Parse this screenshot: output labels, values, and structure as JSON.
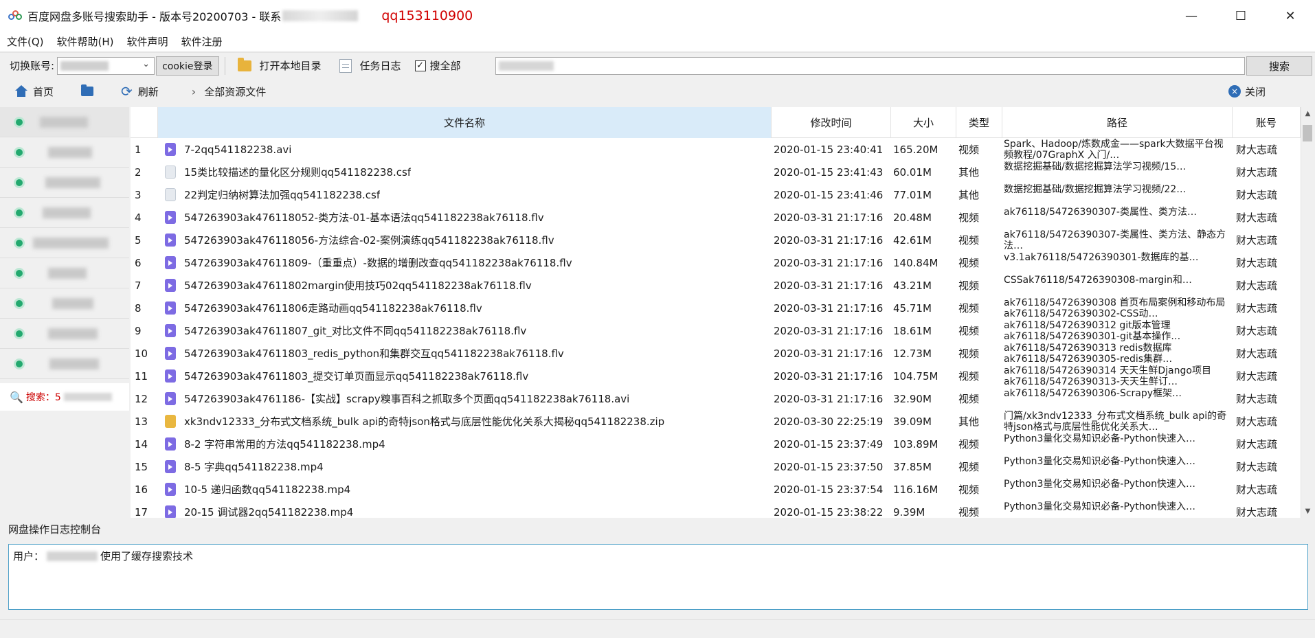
{
  "window": {
    "title": "百度网盘多账号搜索助手 - 版本号20200703 - 联系",
    "contact_qq": "qq153110900",
    "minimize": "—",
    "maximize": "☐",
    "close": "✕"
  },
  "menu": [
    {
      "label": "文件(Q)"
    },
    {
      "label": "软件帮助(H)"
    },
    {
      "label": "软件声明"
    },
    {
      "label": "软件注册"
    }
  ],
  "toolbar": {
    "switch_account_label": "切换账号:",
    "cookie_login": "cookie登录",
    "open_local_dir": "打开本地目录",
    "task_log": "任务日志",
    "search_all_checked": "✓",
    "search_all_label": "搜全部",
    "search_button": "搜索"
  },
  "nav": {
    "home": "首页",
    "refresh": "刷新",
    "chevron": "›",
    "breadcrumb": "全部资源文件",
    "close": "关闭",
    "close_x": "×"
  },
  "sidebar": {
    "search_icon": "🔍",
    "search_label": "搜索：5"
  },
  "table": {
    "headers": {
      "name": "文件名称",
      "modified": "修改时间",
      "size": "大小",
      "type": "类型",
      "path": "路径",
      "account": "账号"
    },
    "rows": [
      {
        "idx": "1",
        "icon": "video",
        "name": "7-2qq541182238.avi",
        "time": "2020-01-15 23:40:41",
        "size": "165.20M",
        "type": "视频",
        "path": "Spark、Hadoop/炼数成金——spark大数据平台视频教程/07GraphX 入门/…",
        "account": "财大志疏"
      },
      {
        "idx": "2",
        "icon": "doc",
        "name": "15类比较描述的量化区分规则qq541182238.csf",
        "time": "2020-01-15 23:41:43",
        "size": "60.01M",
        "type": "其他",
        "path": "数据挖掘基础/数据挖掘算法学习视频/15…",
        "account": "财大志疏"
      },
      {
        "idx": "3",
        "icon": "doc",
        "name": "22判定归纳树算法加强qq541182238.csf",
        "time": "2020-01-15 23:41:46",
        "size": "77.01M",
        "type": "其他",
        "path": "数据挖掘基础/数据挖掘算法学习视频/22…",
        "account": "财大志疏"
      },
      {
        "idx": "4",
        "icon": "video",
        "name": "547263903ak476118052-类方法-01-基本语法qq541182238ak76118.flv",
        "time": "2020-03-31 21:17:16",
        "size": "20.48M",
        "type": "视频",
        "path": "ak76118/54726390307-类属性、类方法…",
        "account": "财大志疏"
      },
      {
        "idx": "5",
        "icon": "video",
        "name": "547263903ak476118056-方法综合-02-案例演练qq541182238ak76118.flv",
        "time": "2020-03-31 21:17:16",
        "size": "42.61M",
        "type": "视频",
        "path": "ak76118/54726390307-类属性、类方法、静态方法…",
        "account": "财大志疏"
      },
      {
        "idx": "6",
        "icon": "video",
        "name": "547263903ak47611809-（重重点）-数据的增删改查qq541182238ak76118.flv",
        "time": "2020-03-31 21:17:16",
        "size": "140.84M",
        "type": "视频",
        "path": "v3.1ak76118/54726390301-数据库的基…",
        "account": "财大志疏"
      },
      {
        "idx": "7",
        "icon": "video",
        "name": "547263903ak47611802margin使用技巧02qq541182238ak76118.flv",
        "time": "2020-03-31 21:17:16",
        "size": "43.21M",
        "type": "视频",
        "path": "CSSak76118/54726390308-margin和…",
        "account": "财大志疏"
      },
      {
        "idx": "8",
        "icon": "video",
        "name": "547263903ak47611806走路动画qq541182238ak76118.flv",
        "time": "2020-03-31 21:17:16",
        "size": "45.71M",
        "type": "视频",
        "path": "ak76118/54726390308 首页布局案例和移动布局ak76118/54726390302-CSS动…",
        "account": "财大志疏"
      },
      {
        "idx": "9",
        "icon": "video",
        "name": "547263903ak47611807_git_对比文件不同qq541182238ak76118.flv",
        "time": "2020-03-31 21:17:16",
        "size": "18.61M",
        "type": "视频",
        "path": "ak76118/54726390312 git版本管理 ak76118/54726390301-git基本操作…",
        "account": "财大志疏"
      },
      {
        "idx": "10",
        "icon": "video",
        "name": "547263903ak47611803_redis_python和集群交互qq541182238ak76118.flv",
        "time": "2020-03-31 21:17:16",
        "size": "12.73M",
        "type": "视频",
        "path": "ak76118/54726390313 redis数据库 ak76118/54726390305-redis集群…",
        "account": "财大志疏"
      },
      {
        "idx": "11",
        "icon": "video",
        "name": "547263903ak47611803_提交订单页面显示qq541182238ak76118.flv",
        "time": "2020-03-31 21:17:16",
        "size": "104.75M",
        "type": "视频",
        "path": "ak76118/54726390314 天天生鲜Django项目ak76118/54726390313-天天生鲜订…",
        "account": "财大志疏"
      },
      {
        "idx": "12",
        "icon": "video",
        "name": "547263903ak4761186-【实战】scrapy糗事百科之抓取多个页面qq541182238ak76118.avi",
        "time": "2020-03-31 21:17:16",
        "size": "32.90M",
        "type": "视频",
        "path": "ak76118/54726390306-Scrapy框架…",
        "account": "财大志疏"
      },
      {
        "idx": "13",
        "icon": "zip",
        "name": "xk3ndv12333_分布式文档系统_bulk api的奇特json格式与底层性能优化关系大揭秘qq541182238.zip",
        "time": "2020-03-30 22:25:19",
        "size": "39.09M",
        "type": "其他",
        "path": "门篇/xk3ndv12333_分布式文档系统_bulk api的奇特json格式与底层性能优化关系大…",
        "account": "财大志疏"
      },
      {
        "idx": "14",
        "icon": "video",
        "name": "8-2 字符串常用的方法qq541182238.mp4",
        "time": "2020-01-15 23:37:49",
        "size": "103.89M",
        "type": "视频",
        "path": "Python3量化交易知识必备-Python快速入…",
        "account": "财大志疏"
      },
      {
        "idx": "15",
        "icon": "video",
        "name": "8-5 字典qq541182238.mp4",
        "time": "2020-01-15 23:37:50",
        "size": "37.85M",
        "type": "视频",
        "path": "Python3量化交易知识必备-Python快速入…",
        "account": "财大志疏"
      },
      {
        "idx": "16",
        "icon": "video",
        "name": "10-5 递归函数qq541182238.mp4",
        "time": "2020-01-15 23:37:54",
        "size": "116.16M",
        "type": "视频",
        "path": "Python3量化交易知识必备-Python快速入…",
        "account": "财大志疏"
      },
      {
        "idx": "17",
        "icon": "video",
        "name": "20-15 调试器2qq541182238.mp4",
        "time": "2020-01-15 23:38:22",
        "size": "9.39M",
        "type": "视频",
        "path": "Python3量化交易知识必备-Python快速入…",
        "account": "财大志疏"
      }
    ]
  },
  "log": {
    "title": "网盘操作日志控制台",
    "user_prefix": "用户：",
    "message": "使用了缓存搜索技术"
  }
}
